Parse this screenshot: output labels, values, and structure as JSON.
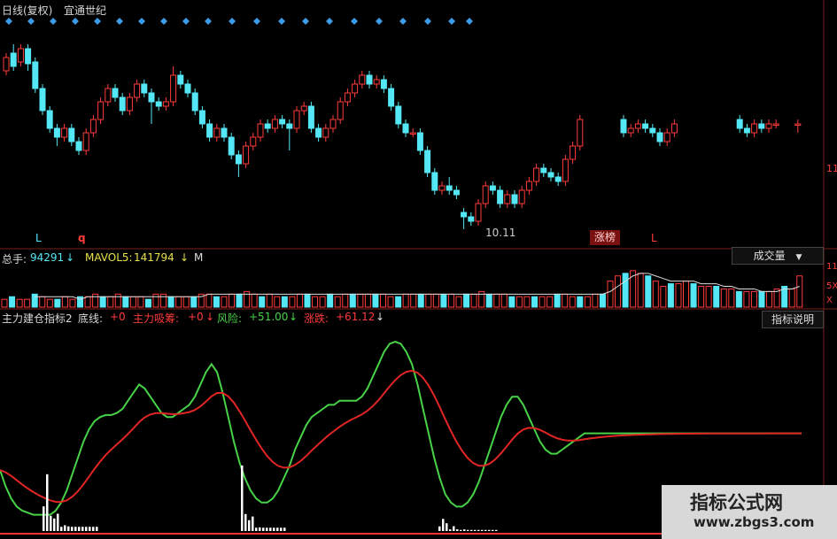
{
  "price_panel": {
    "title": "日线(复权)",
    "stock_name": "宜通世纪",
    "low_marker": "10.11",
    "badge": "涨榜",
    "letters": [
      "L",
      "q",
      "L"
    ],
    "right_axis_label": "11",
    "icon": "diamond-marker-icon"
  },
  "volume_panel": {
    "total_label": "总手:",
    "total_value": "94291",
    "mavol_label": "MAVOL5:",
    "mavol_value": "141794",
    "truncated_label": "M",
    "button_label": "成交量",
    "right_labels": [
      "11",
      "5X",
      "X"
    ]
  },
  "indicator_panel": {
    "name": "主力建仓指标2",
    "baseline_label": "底线:",
    "baseline_value": "+0",
    "absorb_label": "主力吸筹:",
    "absorb_value": "+0",
    "risk_label": "风险:",
    "risk_value": "+51.00",
    "change_label": "涨跌:",
    "change_value": "+61.12",
    "help_button": "指标说明"
  },
  "watermark": {
    "title": "指标公式网",
    "url": "www.zbgs3.com"
  },
  "colors": {
    "up": "#ff3b3b",
    "down": "#54e7f5",
    "green_line": "#47d247",
    "red_line": "#e02525",
    "yellow": "#e8e04a",
    "baseline": "#ff3333"
  },
  "chart_data": [
    {
      "type": "candlestick",
      "title": "日线(复权)",
      "annotation": "10.11",
      "candles": [
        [
          11.9,
          12.05,
          11.85,
          12.1
        ],
        [
          12.1,
          11.95,
          11.9,
          12.2
        ],
        [
          12.0,
          12.15,
          11.95,
          12.2
        ],
        [
          12.15,
          11.98,
          11.9,
          12.2
        ],
        [
          12.0,
          11.7,
          11.65,
          12.05
        ],
        [
          11.7,
          11.45,
          11.4,
          11.75
        ],
        [
          11.45,
          11.25,
          11.2,
          11.5
        ],
        [
          11.25,
          11.15,
          11.05,
          11.3
        ],
        [
          11.15,
          11.25,
          11.1,
          11.3
        ],
        [
          11.25,
          11.1,
          11.05,
          11.3
        ],
        [
          11.1,
          11.0,
          10.95,
          11.15
        ],
        [
          11.0,
          11.2,
          10.95,
          11.25
        ],
        [
          11.2,
          11.35,
          11.15,
          11.4
        ],
        [
          11.35,
          11.55,
          11.3,
          11.6
        ],
        [
          11.55,
          11.7,
          11.5,
          11.75
        ],
        [
          11.7,
          11.6,
          11.55,
          11.75
        ],
        [
          11.6,
          11.45,
          11.4,
          11.65
        ],
        [
          11.45,
          11.6,
          11.4,
          11.65
        ],
        [
          11.6,
          11.75,
          11.55,
          11.8
        ],
        [
          11.75,
          11.65,
          11.6,
          11.8
        ],
        [
          11.65,
          11.55,
          11.3,
          11.7
        ],
        [
          11.55,
          11.5,
          11.45,
          11.6
        ],
        [
          11.5,
          11.55,
          11.45,
          11.6
        ],
        [
          11.55,
          11.85,
          11.5,
          11.95
        ],
        [
          11.85,
          11.75,
          11.7,
          11.9
        ],
        [
          11.75,
          11.65,
          11.6,
          11.8
        ],
        [
          11.65,
          11.45,
          11.4,
          11.7
        ],
        [
          11.45,
          11.3,
          11.25,
          11.5
        ],
        [
          11.3,
          11.15,
          11.1,
          11.35
        ],
        [
          11.15,
          11.25,
          11.1,
          11.3
        ],
        [
          11.25,
          11.15,
          11.1,
          11.3
        ],
        [
          11.15,
          10.95,
          10.9,
          11.2
        ],
        [
          10.95,
          10.85,
          10.7,
          11.0
        ],
        [
          10.85,
          11.05,
          10.8,
          11.1
        ],
        [
          11.05,
          11.15,
          11.0,
          11.2
        ],
        [
          11.15,
          11.3,
          11.1,
          11.35
        ],
        [
          11.3,
          11.25,
          11.2,
          11.35
        ],
        [
          11.25,
          11.35,
          11.2,
          11.4
        ],
        [
          11.35,
          11.3,
          11.25,
          11.4
        ],
        [
          11.3,
          11.25,
          11.0,
          11.35
        ],
        [
          11.25,
          11.45,
          11.2,
          11.5
        ],
        [
          11.45,
          11.5,
          11.4,
          11.55
        ],
        [
          11.5,
          11.25,
          11.2,
          11.55
        ],
        [
          11.25,
          11.15,
          11.1,
          11.3
        ],
        [
          11.15,
          11.25,
          11.1,
          11.3
        ],
        [
          11.25,
          11.35,
          11.2,
          11.4
        ],
        [
          11.35,
          11.55,
          11.3,
          11.6
        ],
        [
          11.55,
          11.65,
          11.5,
          11.7
        ],
        [
          11.65,
          11.75,
          11.6,
          11.8
        ],
        [
          11.75,
          11.85,
          11.7,
          11.9
        ],
        [
          11.85,
          11.75,
          11.7,
          11.9
        ],
        [
          11.75,
          11.8,
          11.7,
          11.85
        ],
        [
          11.8,
          11.7,
          11.65,
          11.85
        ],
        [
          11.7,
          11.5,
          11.45,
          11.75
        ],
        [
          11.5,
          11.3,
          11.25,
          11.55
        ],
        [
          11.3,
          11.2,
          11.15,
          11.35
        ],
        [
          11.2,
          11.2,
          11.15,
          11.25
        ],
        [
          11.2,
          11.0,
          10.95,
          11.25
        ],
        [
          11.0,
          10.75,
          10.7,
          11.05
        ],
        [
          10.75,
          10.55,
          10.5,
          10.8
        ],
        [
          10.55,
          10.6,
          10.5,
          10.65
        ],
        [
          10.6,
          10.55,
          10.5,
          10.7
        ],
        [
          10.55,
          10.5,
          10.45,
          10.6
        ],
        [
          10.3,
          10.25,
          10.11,
          10.35
        ],
        [
          10.25,
          10.2,
          10.15,
          10.3
        ],
        [
          10.2,
          10.4,
          10.15,
          10.45
        ],
        [
          10.4,
          10.6,
          10.35,
          10.65
        ],
        [
          10.6,
          10.55,
          10.5,
          10.65
        ],
        [
          10.55,
          10.4,
          10.35,
          10.6
        ],
        [
          10.4,
          10.5,
          10.35,
          10.55
        ],
        [
          10.5,
          10.4,
          10.35,
          10.55
        ],
        [
          10.4,
          10.55,
          10.35,
          10.6
        ],
        [
          10.55,
          10.65,
          10.5,
          10.7
        ],
        [
          10.65,
          10.8,
          10.6,
          10.85
        ],
        [
          10.8,
          10.75,
          10.7,
          10.85
        ],
        [
          10.75,
          10.7,
          10.65,
          10.8
        ],
        [
          10.7,
          10.65,
          10.6,
          10.75
        ],
        [
          10.65,
          10.9,
          10.6,
          10.95
        ],
        [
          10.9,
          11.05,
          10.85,
          11.1
        ],
        [
          11.05,
          11.35,
          11.0,
          11.4
        ],
        null,
        null,
        null,
        null,
        null,
        [
          11.35,
          11.2,
          11.15,
          11.4
        ],
        [
          11.2,
          11.25,
          11.15,
          11.3
        ],
        [
          11.25,
          11.3,
          11.2,
          11.35
        ],
        [
          11.3,
          11.25,
          11.2,
          11.35
        ],
        [
          11.25,
          11.2,
          11.15,
          11.3
        ],
        [
          11.2,
          11.1,
          11.05,
          11.25
        ],
        [
          11.1,
          11.2,
          11.05,
          11.25
        ],
        [
          11.2,
          11.3,
          11.15,
          11.35
        ],
        null,
        null,
        null,
        null,
        null,
        null,
        null,
        null,
        [
          11.35,
          11.25,
          11.2,
          11.4
        ],
        [
          11.25,
          11.2,
          11.15,
          11.3
        ],
        [
          11.2,
          11.3,
          11.15,
          11.35
        ],
        [
          11.3,
          11.25,
          11.2,
          11.35
        ],
        [
          11.25,
          11.3,
          11.2,
          11.35
        ],
        [
          11.3,
          11.3,
          11.25,
          11.35
        ],
        null,
        null,
        [
          11.3,
          11.3,
          11.2,
          11.35
        ]
      ]
    },
    {
      "type": "bar",
      "title": "成交量",
      "values": [
        3,
        4,
        3,
        3,
        5,
        4,
        3,
        3,
        4,
        3,
        4,
        4,
        5,
        4,
        4,
        5,
        4,
        4,
        4,
        3,
        5,
        5,
        4,
        4,
        4,
        4,
        5,
        5,
        4,
        4,
        5,
        5,
        6,
        5,
        4,
        5,
        4,
        4,
        4,
        5,
        5,
        4,
        4,
        5,
        4,
        5,
        5,
        5,
        5,
        5,
        5,
        4,
        4,
        5,
        5,
        5,
        5,
        5,
        5,
        5,
        4,
        5,
        5,
        6,
        5,
        5,
        5,
        4,
        4,
        4,
        4,
        4,
        4,
        5,
        5,
        4,
        4,
        4,
        5,
        5,
        10,
        12,
        13,
        14,
        13,
        12,
        10,
        8,
        9,
        9,
        10,
        9,
        8,
        8,
        8,
        7,
        7,
        6,
        6,
        6,
        6,
        6,
        7,
        8,
        7,
        12
      ],
      "series": [
        {
          "name": "MAVOL5",
          "values": [
            null,
            null,
            null,
            null,
            4,
            4,
            4,
            4,
            4,
            4,
            3,
            4,
            4,
            4,
            4,
            4,
            4,
            4,
            4,
            4,
            4,
            4,
            4,
            4,
            4,
            4,
            4,
            5,
            5,
            5,
            5,
            5,
            5,
            5,
            5,
            5,
            5,
            5,
            5,
            5,
            5,
            5,
            5,
            5,
            5,
            5,
            5,
            5,
            5,
            5,
            5,
            5,
            5,
            5,
            5,
            5,
            5,
            5,
            5,
            5,
            5,
            5,
            5,
            5,
            5,
            5,
            5,
            5,
            5,
            5,
            5,
            5,
            5,
            5,
            5,
            5,
            5,
            5,
            5,
            5,
            6,
            8,
            10,
            12,
            13,
            13,
            12,
            11,
            10,
            10,
            10,
            10,
            9,
            9,
            9,
            8,
            8,
            7,
            7,
            7,
            6,
            6,
            6,
            7,
            7,
            8
          ]
        }
      ]
    },
    {
      "type": "line",
      "title": "主力建仓指标2",
      "ylim": [
        0,
        100
      ],
      "series": [
        {
          "name": "风险",
          "values": [
            30,
            22,
            16,
            12,
            10,
            9,
            8,
            8,
            8,
            8,
            10,
            14,
            20,
            28,
            36,
            44,
            50,
            54,
            56,
            57,
            57,
            58,
            60,
            64,
            68,
            72,
            70,
            66,
            62,
            58,
            56,
            56,
            58,
            60,
            62,
            66,
            72,
            78,
            82,
            78,
            68,
            56,
            44,
            34,
            26,
            20,
            16,
            14,
            14,
            16,
            20,
            26,
            32,
            40,
            46,
            52,
            56,
            58,
            60,
            62,
            62,
            64,
            64,
            64,
            64,
            66,
            70,
            76,
            82,
            88,
            92,
            93,
            92,
            88,
            82,
            72,
            60,
            48,
            36,
            26,
            18,
            14,
            12,
            12,
            14,
            18,
            24,
            32,
            40,
            48,
            56,
            62,
            66,
            66,
            62,
            56,
            50,
            44,
            40,
            38,
            38,
            40,
            42,
            44,
            46,
            48,
            48,
            48,
            48,
            48,
            48,
            48,
            48,
            48,
            48,
            48,
            48,
            48,
            48,
            48,
            48,
            48,
            48,
            48,
            48,
            48,
            48,
            48,
            48,
            48,
            48,
            48,
            48,
            48,
            48,
            48,
            48,
            48,
            48,
            48,
            48,
            48,
            48,
            48,
            48
          ]
        },
        {
          "name": "涨跌",
          "values": []
        }
      ],
      "histogram": []
    }
  ]
}
